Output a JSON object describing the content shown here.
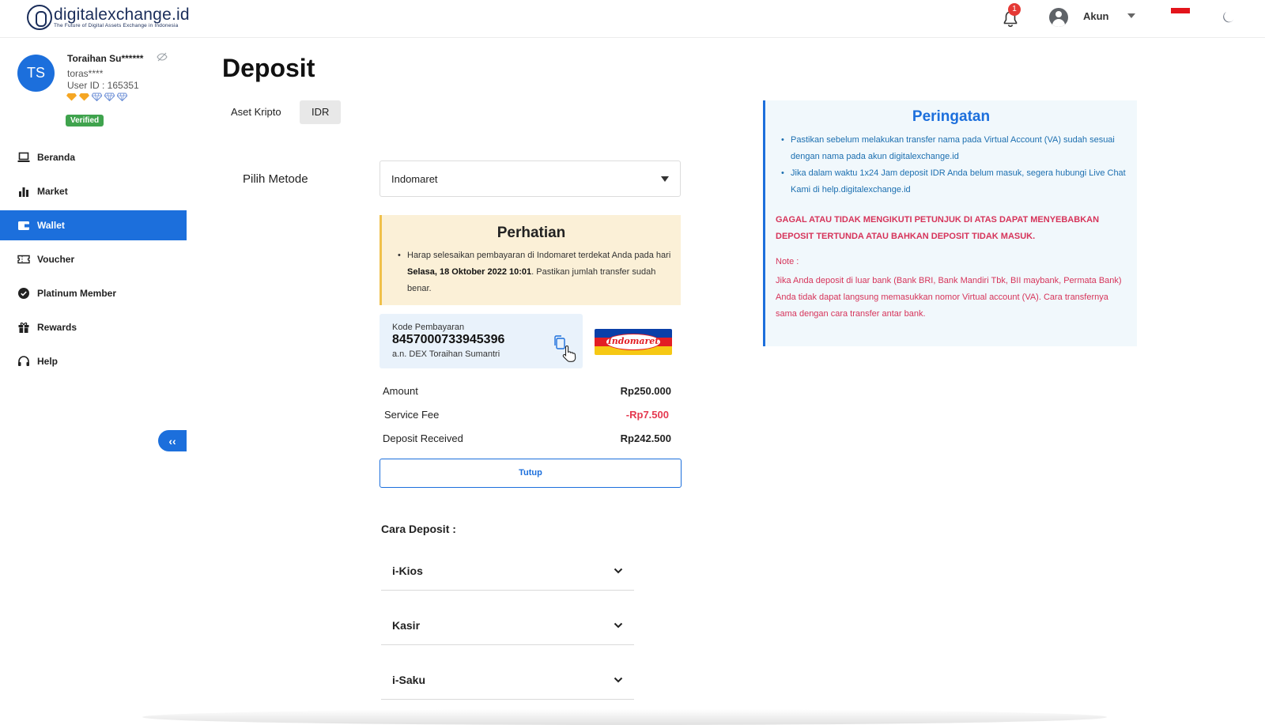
{
  "header": {
    "logo_name": "digitalexchange.id",
    "logo_tagline": "The Future of Digital Assets Exchange in Indonesia",
    "notification_count": "1",
    "account_label": "Akun"
  },
  "profile": {
    "initials": "TS",
    "name": "Toraihan Su******",
    "username": "toras****",
    "user_id": "User ID : 165351",
    "verified_label": "Verified"
  },
  "sidebar": {
    "items": [
      {
        "label": "Beranda",
        "icon": "laptop-icon"
      },
      {
        "label": "Market",
        "icon": "bar-chart-icon"
      },
      {
        "label": "Wallet",
        "icon": "wallet-icon",
        "active": true
      },
      {
        "label": "Voucher",
        "icon": "ticket-icon"
      },
      {
        "label": "Platinum Member",
        "icon": "badge-check-icon"
      },
      {
        "label": "Rewards",
        "icon": "gift-icon"
      },
      {
        "label": "Help",
        "icon": "headset-icon"
      }
    ],
    "collapse_label": "‹‹"
  },
  "main": {
    "title": "Deposit",
    "tabs": [
      {
        "label": "Aset Kripto"
      },
      {
        "label": "IDR",
        "active": true
      }
    ],
    "method_label": "Pilih Metode",
    "method_value": "Indomaret",
    "notice": {
      "title": "Perhatian",
      "text_before": "Harap selesaikan pembayaran di Indomaret terdekat Anda pada hari ",
      "deadline": "Selasa, 18 Oktober 2022 10:01",
      "text_after": ". Pastikan jumlah transfer sudah benar."
    },
    "payment_code": {
      "label": "Kode Pembayaran",
      "value": "8457000733945396",
      "name": "a.n. DEX Toraihan Sumantri"
    },
    "merchant_logo_text": "Indomaret",
    "summary": {
      "amount_label": "Amount",
      "amount_value": "Rp250.000",
      "fee_label": "Service Fee",
      "fee_value": "-Rp7.500",
      "received_label": "Deposit Received",
      "received_value": "Rp242.500"
    },
    "close_button": "Tutup",
    "how_to_title": "Cara Deposit :",
    "how_to_items": [
      "i-Kios",
      "Kasir",
      "i-Saku"
    ]
  },
  "warning": {
    "title": "Peringatan",
    "items": [
      "Pastikan sebelum melakukan transfer nama pada Virtual Account (VA) sudah sesuai dengan nama pada akun digitalexchange.id",
      "Jika dalam waktu 1x24 Jam deposit IDR Anda belum masuk, segera hubungi Live Chat Kami di help.digitalexchange.id"
    ],
    "alert": "GAGAL ATAU TIDAK MENGIKUTI PETUNJUK DI ATAS DAPAT MENYEBABKAN DEPOSIT TERTUNDA ATAU BAHKAN DEPOSIT TIDAK MASUK.",
    "note_label": "Note :",
    "note": "Jika Anda deposit di luar bank (Bank BRI, Bank Mandiri Tbk, BII maybank, Permata Bank) Anda tidak dapat langsung memasukkan nomor Virtual account (VA). Cara transfernya sama dengan cara transfer antar bank."
  },
  "colors": {
    "primary": "#1c6fdc",
    "verified": "#3fa34d",
    "notice_bg": "#fbf0d7",
    "notice_border": "#f0c04a",
    "warning_bg": "#f1f8fc",
    "alert_red": "#d6345a",
    "fee_red": "#e53950"
  }
}
